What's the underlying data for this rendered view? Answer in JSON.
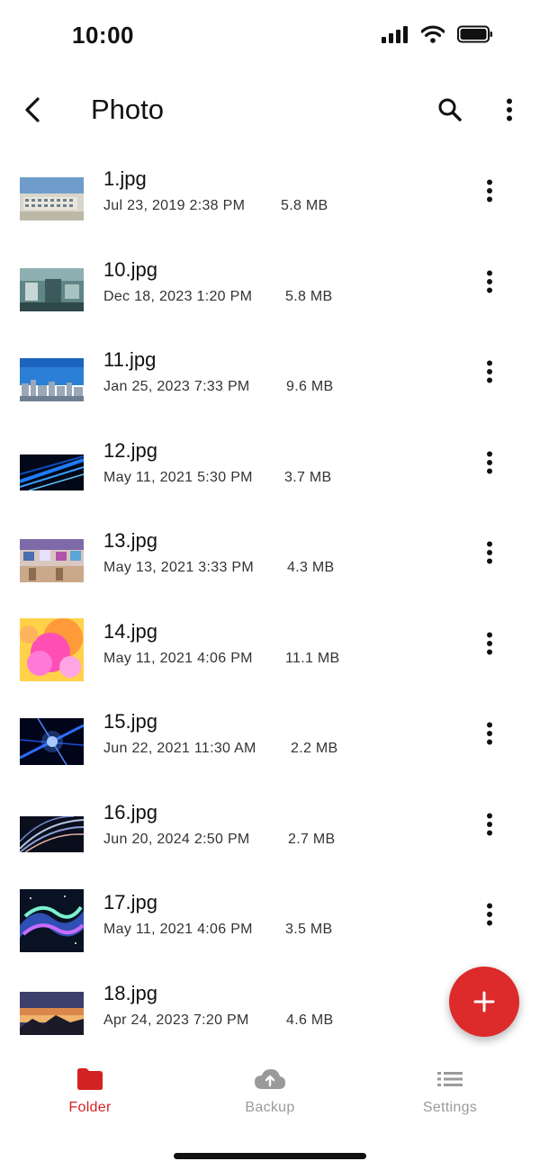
{
  "status_bar": {
    "time": "10:00",
    "icons": [
      "signal-icon",
      "wifi-icon",
      "battery-icon"
    ]
  },
  "app_bar": {
    "title": "Photo",
    "back_icon": "chevron-left-icon",
    "search_icon": "search-icon",
    "more_icon": "more-vertical-icon"
  },
  "files": [
    {
      "name": "1.jpg",
      "date": "Jul 23, 2019 2:38 PM",
      "size": "5.8 MB"
    },
    {
      "name": "10.jpg",
      "date": "Dec 18, 2023 1:20 PM",
      "size": "5.8 MB"
    },
    {
      "name": "11.jpg",
      "date": "Jan 25, 2023 7:33 PM",
      "size": "9.6 MB"
    },
    {
      "name": "12.jpg",
      "date": "May 11, 2021 5:30 PM",
      "size": "3.7 MB"
    },
    {
      "name": "13.jpg",
      "date": "May 13, 2021 3:33 PM",
      "size": "4.3 MB"
    },
    {
      "name": "14.jpg",
      "date": "May 11, 2021 4:06 PM",
      "size": "11.1 MB"
    },
    {
      "name": "15.jpg",
      "date": "Jun 22, 2021 11:30 AM",
      "size": "2.2 MB"
    },
    {
      "name": "16.jpg",
      "date": "Jun 20, 2024 2:50 PM",
      "size": "2.7 MB"
    },
    {
      "name": "17.jpg",
      "date": "May 11, 2021 4:06 PM",
      "size": "3.5 MB"
    },
    {
      "name": "18.jpg",
      "date": "Apr 24, 2023 7:20 PM",
      "size": "4.6 MB"
    }
  ],
  "fab": {
    "icon": "plus-icon"
  },
  "bottom_nav": [
    {
      "label": "Folder",
      "icon": "folder-icon",
      "active": true
    },
    {
      "label": "Backup",
      "icon": "cloud-upload-icon",
      "active": false
    },
    {
      "label": "Settings",
      "icon": "list-icon",
      "active": false
    }
  ],
  "colors": {
    "accent": "#d32222",
    "fab": "#dd2a2a",
    "inactive": "#9a9a9a"
  }
}
